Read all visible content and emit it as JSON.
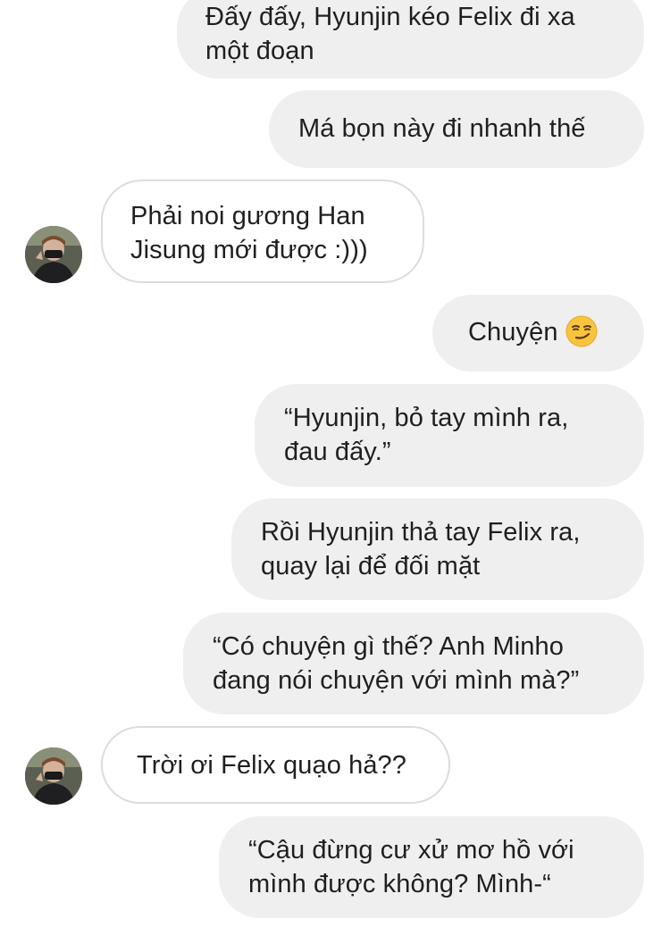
{
  "messages": [
    {
      "side": "out",
      "text": "Đấy đấy, Hyunjin kéo Felix đi xa\nmột đoạn"
    },
    {
      "side": "out",
      "text": "Má bọn này đi nhanh thế"
    },
    {
      "side": "in",
      "text": "Phải noi gương Han\nJisung mới được :)))"
    },
    {
      "side": "out",
      "text": "Chuyện",
      "emoji": "smirking-face-emoji"
    },
    {
      "side": "out",
      "text": "“Hyunjin, bỏ tay mình ra,\nđau đấy.”"
    },
    {
      "side": "out",
      "text": "Rồi Hyunjin thả tay Felix ra,\nquay lại để đối mặt"
    },
    {
      "side": "out",
      "text": "“Có chuyện gì thế? Anh Minho\nđang nói chuyện với mình mà?”"
    },
    {
      "side": "in",
      "text": "Trời ơi Felix quạo hả??"
    },
    {
      "side": "out",
      "text": "“Cậu đừng cư xử mơ hồ với\nmình được không? Mình-“"
    }
  ],
  "colors": {
    "outgoing_bubble": "#efefef",
    "incoming_bubble": "#ffffff",
    "incoming_border": "#dcdcdc",
    "text": "#1f1f1f"
  }
}
